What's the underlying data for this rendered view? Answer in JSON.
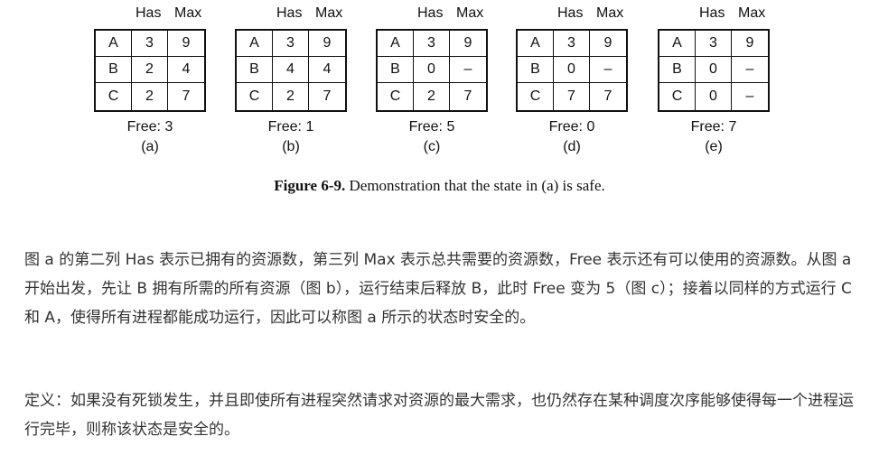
{
  "figure": {
    "column_headers": {
      "has": "Has",
      "max": "Max"
    },
    "states": [
      {
        "label": "(a)",
        "free": "Free: 3",
        "rows": [
          [
            "A",
            "3",
            "9"
          ],
          [
            "B",
            "2",
            "4"
          ],
          [
            "C",
            "2",
            "7"
          ]
        ]
      },
      {
        "label": "(b)",
        "free": "Free: 1",
        "rows": [
          [
            "A",
            "3",
            "9"
          ],
          [
            "B",
            "4",
            "4"
          ],
          [
            "C",
            "2",
            "7"
          ]
        ]
      },
      {
        "label": "(c)",
        "free": "Free: 5",
        "rows": [
          [
            "A",
            "3",
            "9"
          ],
          [
            "B",
            "0",
            "–"
          ],
          [
            "C",
            "2",
            "7"
          ]
        ]
      },
      {
        "label": "(d)",
        "free": "Free: 0",
        "rows": [
          [
            "A",
            "3",
            "9"
          ],
          [
            "B",
            "0",
            "–"
          ],
          [
            "C",
            "7",
            "7"
          ]
        ]
      },
      {
        "label": "(e)",
        "free": "Free: 7",
        "rows": [
          [
            "A",
            "3",
            "9"
          ],
          [
            "B",
            "0",
            "–"
          ],
          [
            "C",
            "0",
            "–"
          ]
        ]
      }
    ],
    "caption_label": "Figure 6-9.",
    "caption_text": " Demonstration that the state in (a) is safe."
  },
  "paragraphs": [
    "图 a 的第二列 Has 表示已拥有的资源数，第三列 Max 表示总共需要的资源数，Free 表示还有可以使用的资源数。从图 a 开始出发，先让 B 拥有所需的所有资源（图 b），运行结束后释放 B，此时 Free 变为 5（图 c）；接着以同样的方式运行 C 和 A，使得所有进程都能成功运行，因此可以称图 a 所示的状态时安全的。",
    "定义：如果没有死锁发生，并且即使所有进程突然请求对资源的最大需求，也仍然存在某种调度次序能够使得每一个进程运行完毕，则称该状态是安全的。"
  ]
}
